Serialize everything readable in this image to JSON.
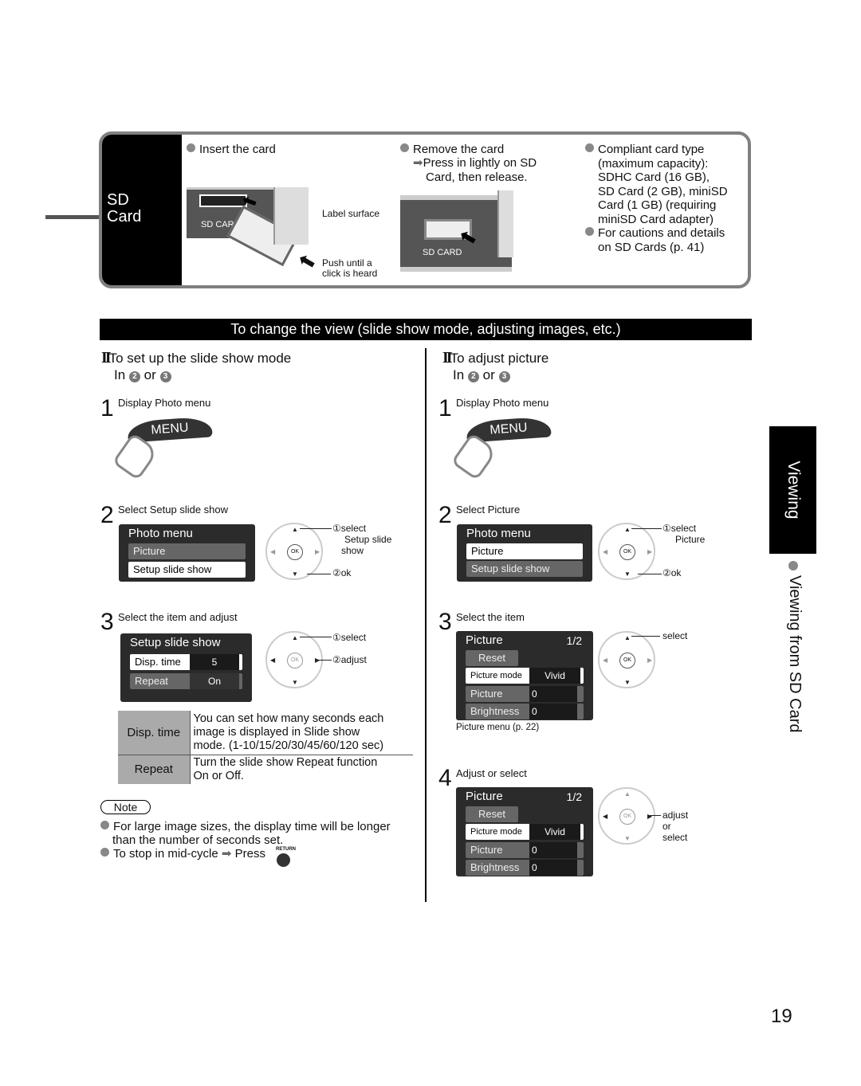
{
  "sd_box": {
    "label_line1": "SD",
    "label_line2": "Card",
    "insert": {
      "title": "Insert the card",
      "slot_label": "SD CARD",
      "callout_label": "Label surface",
      "callout_push_line1": "Push until a",
      "callout_push_line2": "click is heard"
    },
    "remove": {
      "title": "Remove the card",
      "instruction_line1": "Press in lightly on SD",
      "instruction_line2": "Card, then release.",
      "slot_label": "SD CARD"
    },
    "compliant": {
      "lines": [
        "Compliant card type",
        "(maximum capacity):",
        "SDHC Card (16 GB),",
        "SD Card (2 GB), miniSD",
        "Card (1 GB) (requiring",
        "miniSD Card adapter)"
      ],
      "cautions_line1": "For cautions and details",
      "cautions_line2": "on SD Cards (p. 41)"
    }
  },
  "banner": "To change the view (slide show mode, adjusting images, etc.)",
  "left": {
    "marker": "II",
    "heading": "To set up the slide show mode",
    "sub_prefix": "In",
    "sub_a": "2",
    "sub_or": "or",
    "sub_b": "3",
    "step1": {
      "num": "1",
      "text": "Display  Photo menu",
      "button": "MENU"
    },
    "step2": {
      "num": "2",
      "text": "Select  Setup slide show",
      "osd_title": "Photo menu",
      "items": [
        "Picture",
        "Setup slide show"
      ],
      "callout1_line1": "①select",
      "callout1_line2": "Setup slide",
      "callout1_line3": "show",
      "callout2": "②ok",
      "ok_label": "OK"
    },
    "step3": {
      "num": "3",
      "text": "Select the item and adjust",
      "osd_title": "Setup slide show",
      "rows": [
        {
          "label": "Disp. time",
          "value": "5"
        },
        {
          "label": "Repeat",
          "value": "On"
        }
      ],
      "callout1": "①select",
      "callout2": "②adjust",
      "ok_label": "OK"
    },
    "table": [
      {
        "head": "Disp. time",
        "body": [
          "You can set how many seconds each",
          "image is displayed in Slide show",
          "mode. (1-10/15/20/30/45/60/120 sec)"
        ]
      },
      {
        "head": "Repeat",
        "body": [
          "Turn the slide show Repeat function",
          "On or Off."
        ]
      }
    ],
    "note_label": "Note",
    "notes": {
      "n1_line1": "For large image sizes, the display time will be longer",
      "n1_line2": "than the number of seconds set.",
      "n2_text": "To stop in mid-cycle",
      "n2_press": "Press",
      "return_label": "RETURN"
    }
  },
  "right": {
    "marker": "II",
    "heading": "To adjust picture",
    "sub_prefix": "In",
    "sub_a": "2",
    "sub_or": "or",
    "sub_b": "3",
    "step1": {
      "num": "1",
      "text": "Display  Photo menu",
      "button": "MENU"
    },
    "step2": {
      "num": "2",
      "text": "Select  Picture",
      "osd_title": "Photo menu",
      "items": [
        "Picture",
        "Setup slide show"
      ],
      "callout1_line1": "①select",
      "callout1_line2": "Picture",
      "callout2": "②ok",
      "ok_label": "OK"
    },
    "step3": {
      "num": "3",
      "text": "Select the item",
      "osd_title": "Picture",
      "page": "1/2",
      "reset": "Reset",
      "rows": [
        {
          "label": "Picture mode",
          "value": "Vivid"
        },
        {
          "label": "Picture",
          "value": "0"
        },
        {
          "label": "Brightness",
          "value": "0"
        }
      ],
      "callout": "select",
      "caption": "Picture menu (p. 22)",
      "ok_label": "OK"
    },
    "step4": {
      "num": "4",
      "text": "Adjust or select",
      "osd_title": "Picture",
      "page": "1/2",
      "reset": "Reset",
      "rows": [
        {
          "label": "Picture mode",
          "value": "Vivid"
        },
        {
          "label": "Picture",
          "value": "0"
        },
        {
          "label": "Brightness",
          "value": "0"
        }
      ],
      "callout_line1": "adjust",
      "callout_line2": "or",
      "callout_line3": "select",
      "ok_label": "OK"
    }
  },
  "side_tab": "Viewing",
  "side_title": "Viewing from SD Card",
  "page_number": "19"
}
